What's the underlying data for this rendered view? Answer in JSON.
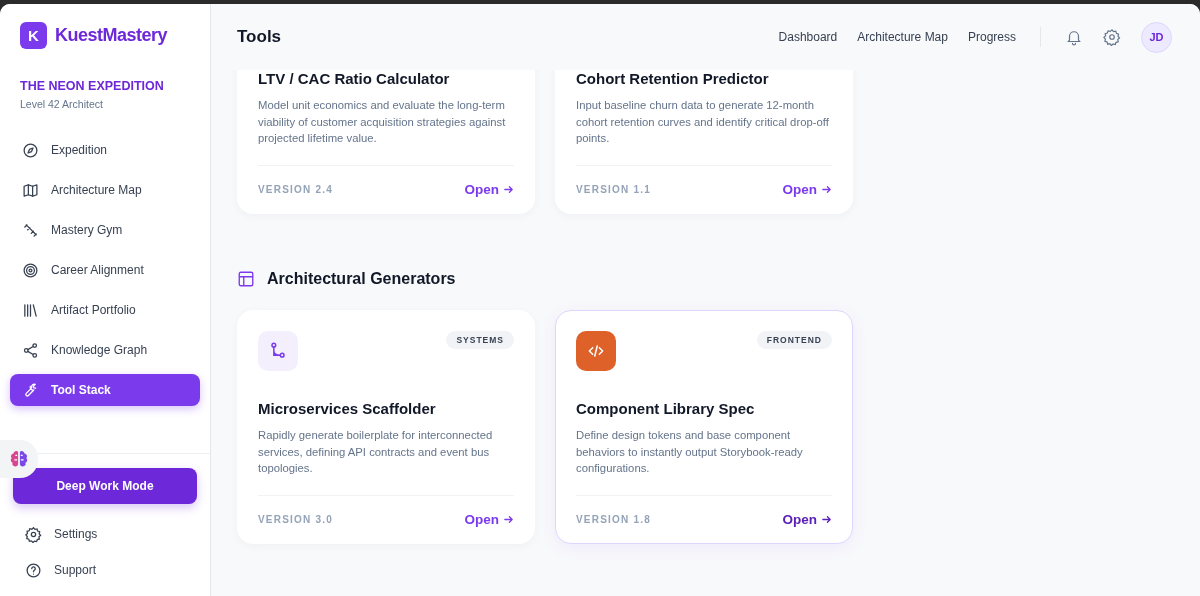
{
  "brand": {
    "logo_letter": "K",
    "name": "KuestMastery"
  },
  "expedition": {
    "title": "THE NEON EXPEDITION",
    "subtitle": "Level 42 Architect"
  },
  "sidebar": {
    "items": [
      {
        "label": "Expedition",
        "selected": false
      },
      {
        "label": "Architecture Map",
        "selected": false
      },
      {
        "label": "Mastery Gym",
        "selected": false
      },
      {
        "label": "Career Alignment",
        "selected": false
      },
      {
        "label": "Artifact Portfolio",
        "selected": false
      },
      {
        "label": "Knowledge Graph",
        "selected": false
      },
      {
        "label": "Tool Stack",
        "selected": true
      }
    ],
    "primary_button": "Deep Work Mode",
    "footer_items": [
      {
        "label": "Settings"
      },
      {
        "label": "Support"
      }
    ]
  },
  "header": {
    "title": "Tools",
    "links": [
      "Dashboard",
      "Architecture Map",
      "Progress"
    ],
    "avatar": "JD"
  },
  "scrolled_cards": [
    {
      "title": "LTV / CAC Ratio Calculator",
      "description": "Model unit economics and evaluate the long-term viability of customer acquisition strategies against projected lifetime value.",
      "version": "VERSION 2.4",
      "action": "Open",
      "hovered": false
    },
    {
      "title": "Cohort Retention Predictor",
      "description": "Input baseline churn data to generate 12-month cohort retention curves and identify critical drop-off points.",
      "version": "VERSION 1.1",
      "action": "Open",
      "hovered": false
    }
  ],
  "section": {
    "title": "Architectural Generators",
    "cards": [
      {
        "tag": "SYSTEMS",
        "color": "#f3effd",
        "title": "Microservices Scaffolder",
        "description": "Rapidly generate boilerplate for interconnected services, defining API contracts and event bus topologies.",
        "version": "VERSION 3.0",
        "action": "Open",
        "hovered": false
      },
      {
        "tag": "FRONTEND",
        "color": "#dd6128",
        "title": "Component Library Spec",
        "description": "Define design tokens and base component behaviors to instantly output Storybook-ready configurations.",
        "version": "VERSION 1.8",
        "action": "Open",
        "hovered": true
      }
    ]
  }
}
